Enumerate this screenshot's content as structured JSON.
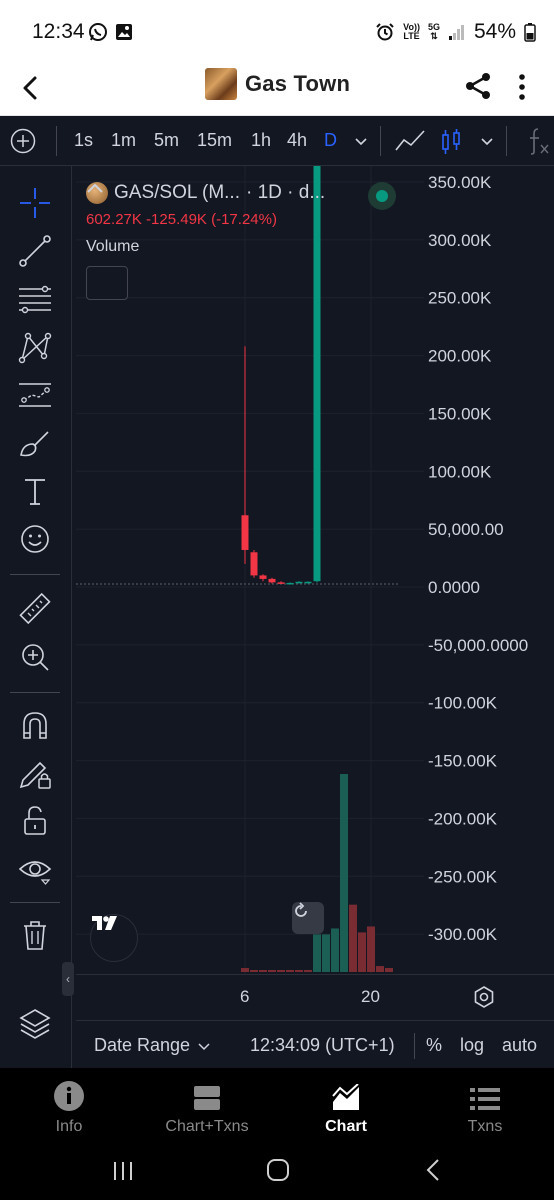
{
  "status_bar": {
    "time": "12:34",
    "volte_top": "Vo))",
    "volte_bottom": "LTE",
    "net_top": "5G",
    "battery": "54%"
  },
  "header": {
    "title": "Gas Town",
    "icons": [
      "back-arrow-icon",
      "token-logo",
      "share-icon",
      "more-vertical-icon"
    ]
  },
  "toolbar": {
    "timeframes": [
      "1s",
      "1m",
      "5m",
      "15m",
      "1h",
      "4h",
      "D"
    ],
    "active_timeframe": "D",
    "accent_color": "#2962ff"
  },
  "legend": {
    "symbol": "GAS/SOL (M...",
    "interval": "· 1D · d...",
    "change": "602.27K  -125.49K (-17.24%)",
    "volume_label": "Volume"
  },
  "chart_data": {
    "type": "candlestick",
    "price_axis_labels": [
      "350.00K",
      "300.00K",
      "250.00K",
      "200.00K",
      "150.00K",
      "100.00K",
      "50,000.00",
      "0.0000",
      "-50,000.0000",
      "-100.00K",
      "-150.00K",
      "-200.00K",
      "-250.00K",
      "-300.00K"
    ],
    "x_tick_labels": [
      "6",
      "20"
    ],
    "ylim": [
      -300000,
      350000
    ],
    "up_color": "#089981",
    "down_color": "#f23645",
    "candles": [
      {
        "day": 6,
        "open": 62000,
        "high": 208000,
        "low": 20000,
        "close": 32000,
        "dir": "down"
      },
      {
        "day": 7,
        "open": 30000,
        "high": 32000,
        "low": 8000,
        "close": 10000,
        "dir": "down"
      },
      {
        "day": 8,
        "open": 10000,
        "high": 11000,
        "low": 5000,
        "close": 7000,
        "dir": "down"
      },
      {
        "day": 9,
        "open": 7000,
        "high": 8000,
        "low": 3000,
        "close": 4000,
        "dir": "down"
      },
      {
        "day": 10,
        "open": 4000,
        "high": 5000,
        "low": 3000,
        "close": 3000,
        "dir": "down"
      },
      {
        "day": 11,
        "open": 3000,
        "high": 4000,
        "low": 2000,
        "close": 3500,
        "dir": "up"
      },
      {
        "day": 12,
        "open": 3500,
        "high": 5000,
        "low": 3000,
        "close": 4500,
        "dir": "up"
      },
      {
        "day": 13,
        "open": 3500,
        "high": 5000,
        "low": 3000,
        "close": 4500,
        "dir": "up"
      },
      {
        "day": 14,
        "open": 5000,
        "high": 600000,
        "low": 4000,
        "close": 600000,
        "dir": "up"
      }
    ],
    "volume": [
      {
        "day": 6,
        "value": 0.02,
        "dir": "down"
      },
      {
        "day": 7,
        "value": 0.01,
        "dir": "down"
      },
      {
        "day": 8,
        "value": 0.01,
        "dir": "down"
      },
      {
        "day": 9,
        "value": 0.01,
        "dir": "down"
      },
      {
        "day": 10,
        "value": 0.01,
        "dir": "down"
      },
      {
        "day": 11,
        "value": 0.01,
        "dir": "down"
      },
      {
        "day": 12,
        "value": 0.01,
        "dir": "down"
      },
      {
        "day": 13,
        "value": 0.01,
        "dir": "down"
      },
      {
        "day": 14,
        "value": 0.19,
        "dir": "up"
      },
      {
        "day": 15,
        "value": 0.19,
        "dir": "up"
      },
      {
        "day": 16,
        "value": 0.22,
        "dir": "up"
      },
      {
        "day": 17,
        "value": 1.0,
        "dir": "up"
      },
      {
        "day": 18,
        "value": 0.34,
        "dir": "down"
      },
      {
        "day": 19,
        "value": 0.2,
        "dir": "down"
      },
      {
        "day": 20,
        "value": 0.23,
        "dir": "down"
      },
      {
        "day": 21,
        "value": 0.03,
        "dir": "down"
      },
      {
        "day": 22,
        "value": 0.02,
        "dir": "down"
      }
    ]
  },
  "xaxis": {
    "ticks": [
      "6",
      "20"
    ]
  },
  "chart_bar": {
    "date_range": "Date Range",
    "time": "12:34:09 (UTC+1)",
    "percent": "%",
    "log": "log",
    "auto": "auto"
  },
  "bottom_nav": [
    {
      "label": "Info",
      "active": false
    },
    {
      "label": "Chart+Txns",
      "active": false
    },
    {
      "label": "Chart",
      "active": true
    },
    {
      "label": "Txns",
      "active": false
    }
  ]
}
